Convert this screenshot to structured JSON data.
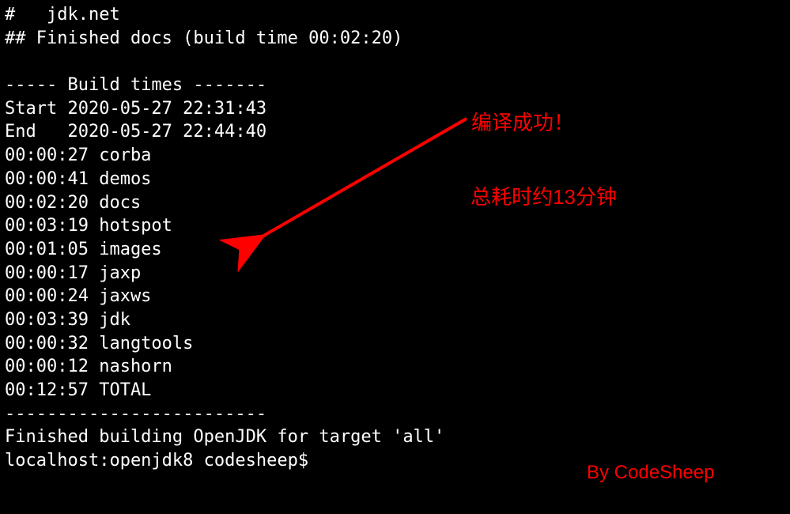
{
  "terminal": {
    "lines": [
      "#   jdk.net",
      "## Finished docs (build time 00:02:20)",
      "",
      "----- Build times -------",
      "Start 2020-05-27 22:31:43",
      "End   2020-05-27 22:44:40",
      "00:00:27 corba",
      "00:00:41 demos",
      "00:02:20 docs",
      "00:03:19 hotspot",
      "00:01:05 images",
      "00:00:17 jaxp",
      "00:00:24 jaxws",
      "00:03:39 jdk",
      "00:00:32 langtools",
      "00:00:12 nashorn",
      "00:12:57 TOTAL",
      "-------------------------",
      "Finished building OpenJDK for target 'all'",
      "localhost:openjdk8 codesheep$"
    ]
  },
  "annotations": {
    "success": "编译成功！",
    "duration": "总耗时约13分钟",
    "author": "By CodeSheep"
  },
  "colors": {
    "annotation": "#ff0000",
    "bg": "#000000",
    "fg": "#ffffff"
  }
}
